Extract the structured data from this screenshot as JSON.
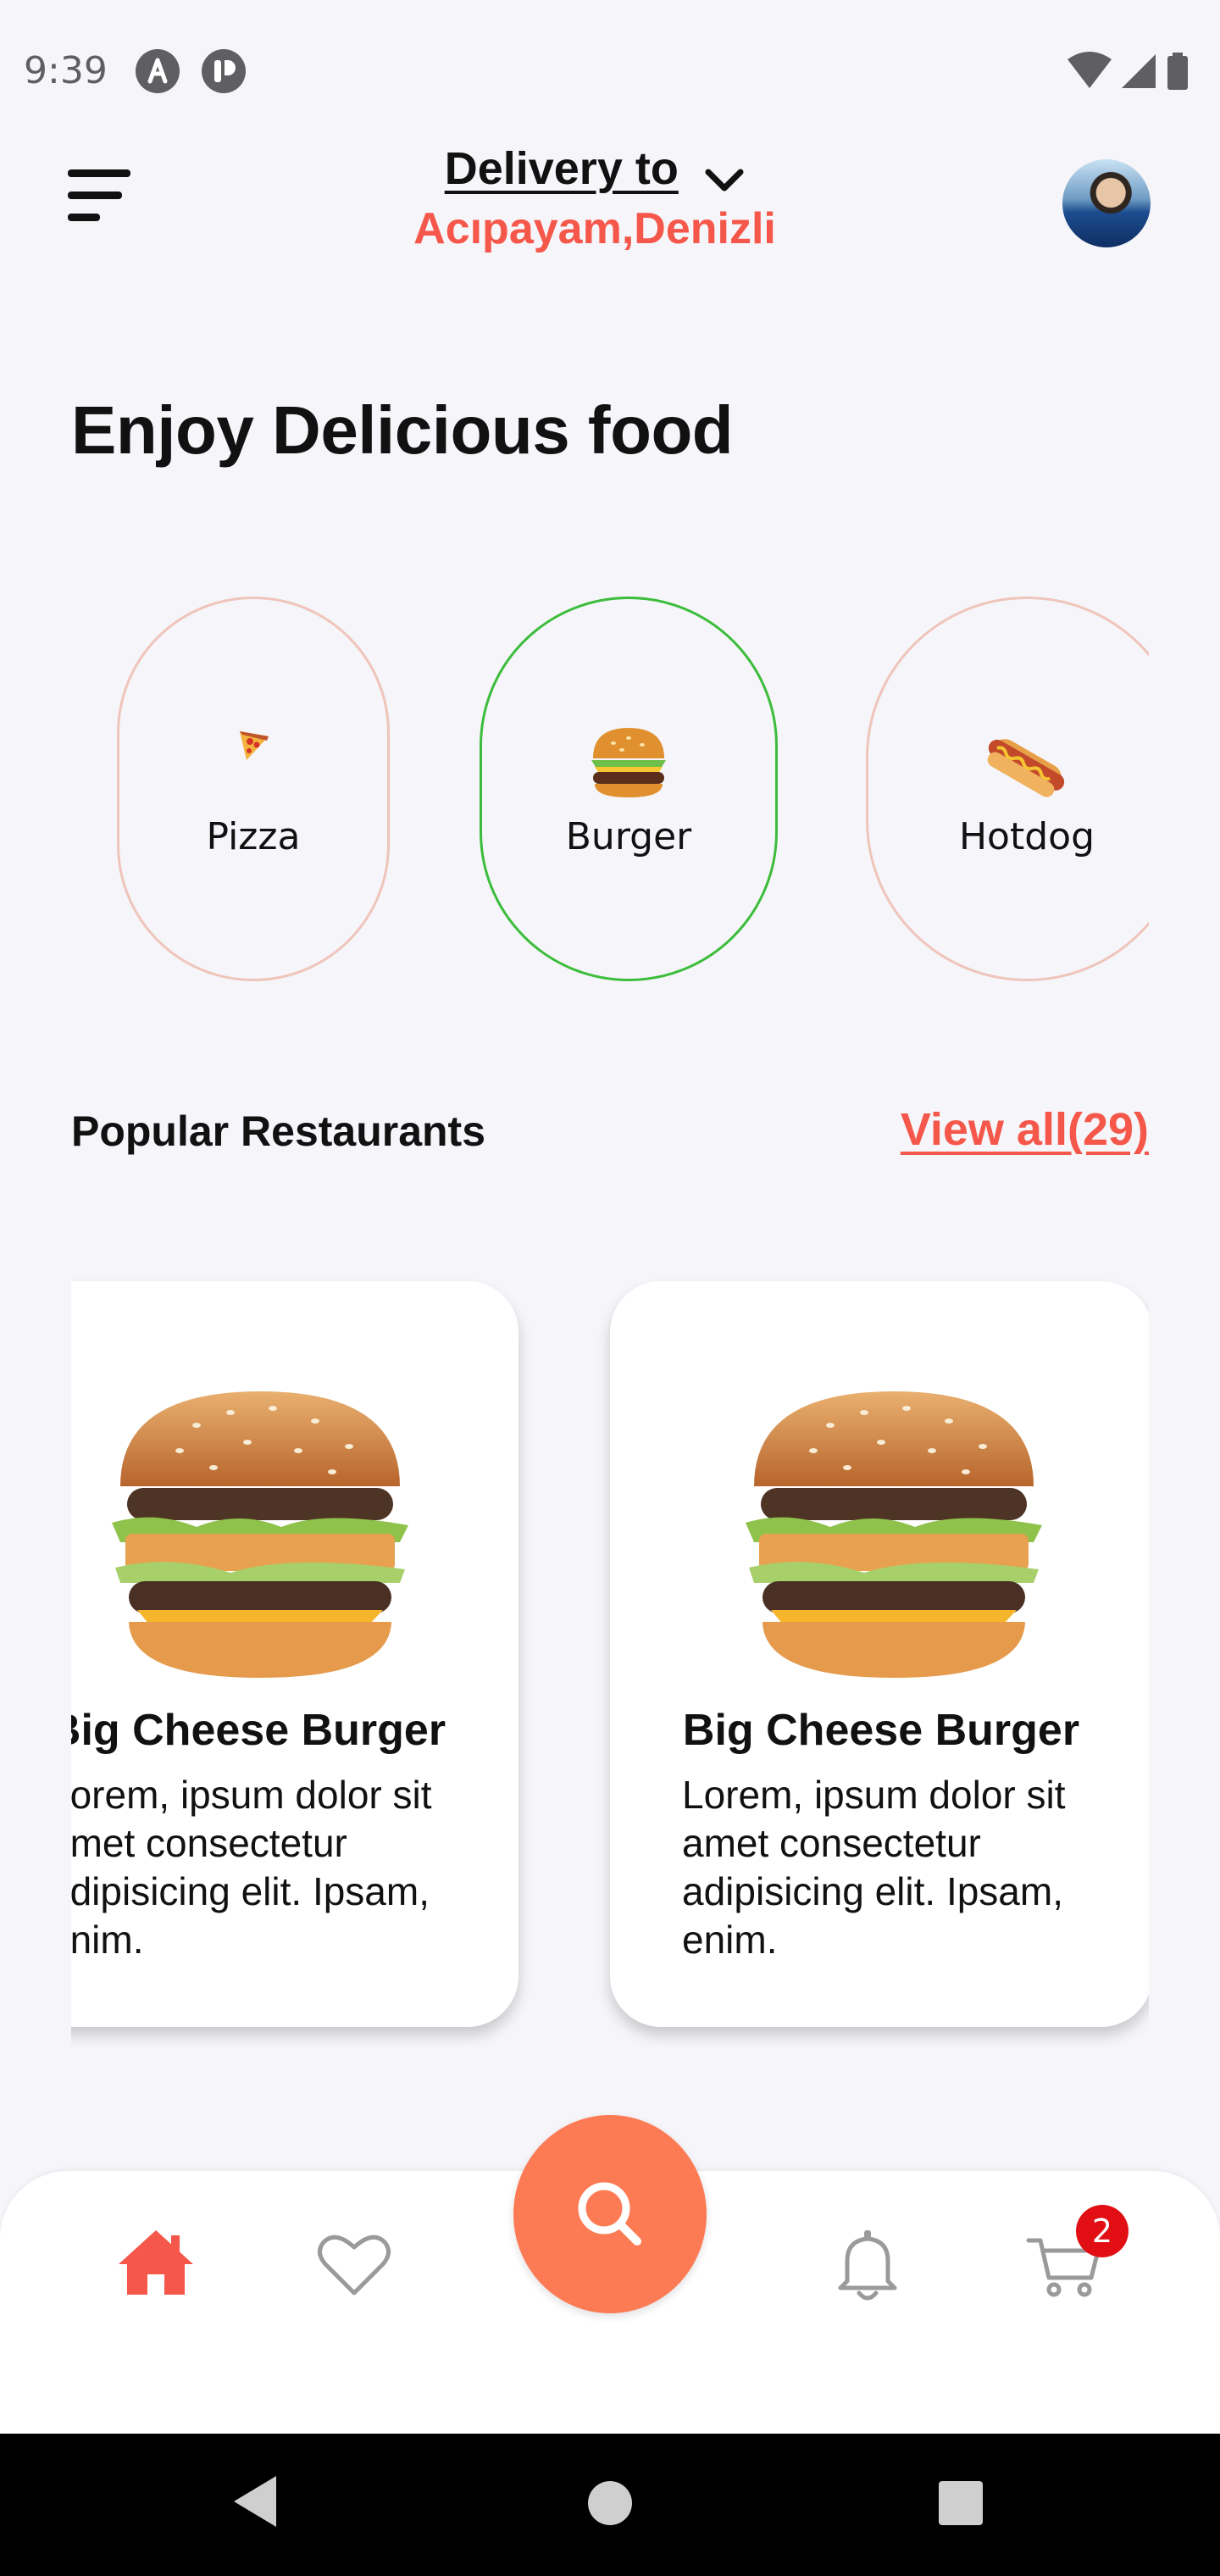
{
  "status_bar": {
    "time": "9:39",
    "icons": [
      "app-a-icon",
      "app-p-icon",
      "wifi-icon",
      "signal-icon",
      "battery-icon"
    ]
  },
  "header": {
    "menu_icon": "menu-icon",
    "delivery_label": "Delivery to",
    "location": "Acıpayam,Denizli",
    "avatar": "avatar"
  },
  "headline": "Enjoy Delicious food",
  "categories": [
    {
      "label": "Pizza",
      "icon": "pizza-icon",
      "selected": false
    },
    {
      "label": "Burger",
      "icon": "burger-icon",
      "selected": true
    },
    {
      "label": "Hotdog",
      "icon": "hotdog-icon",
      "selected": false
    }
  ],
  "popular": {
    "title": "Popular Restaurants",
    "view_all": "View all(29)"
  },
  "restaurants": [
    {
      "name": "Big Cheese Burger",
      "description": "Lorem, ipsum dolor sit amet consectetur adipisicing elit. Ipsam, enim."
    },
    {
      "name": "Big Cheese Burger",
      "description": "Lorem, ipsum dolor sit amet consectetur adipisicing elit. Ipsam, enim."
    }
  ],
  "bottom_nav": {
    "items": [
      "home-icon",
      "heart-icon",
      "search-icon",
      "bell-icon",
      "cart-icon"
    ],
    "active": "home-icon",
    "cart_badge": "2"
  },
  "colors": {
    "accent": "#f5574a",
    "fab": "#fd7b54",
    "selected_border": "#3bbd3b",
    "category_border": "#efc5bb",
    "badge": "#e10f14",
    "background": "#f6f5f9"
  }
}
